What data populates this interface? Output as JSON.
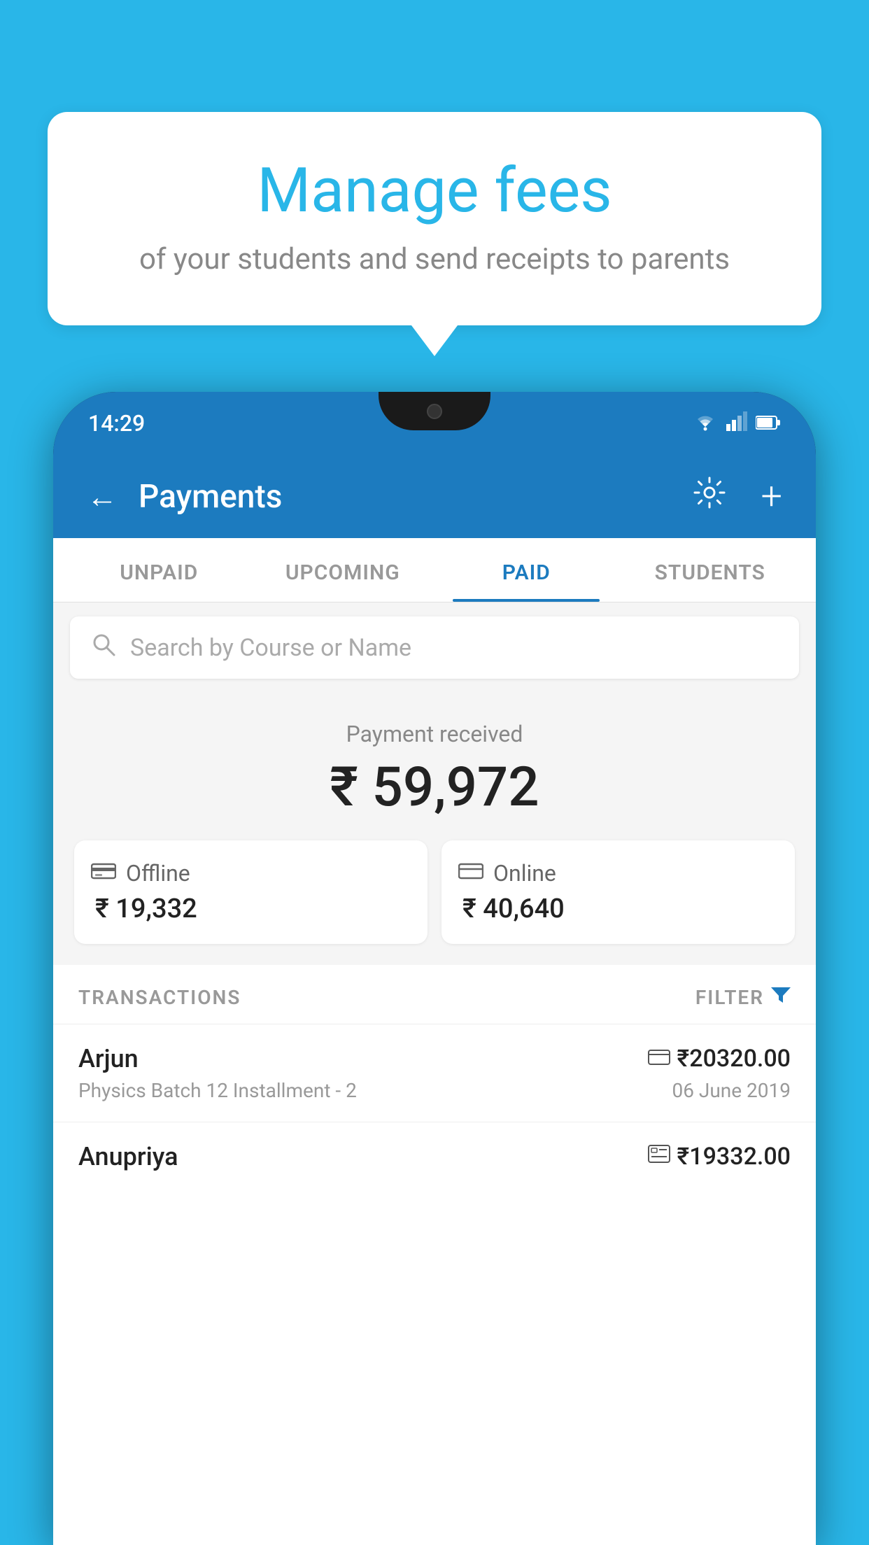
{
  "background_color": "#29B6E8",
  "bubble": {
    "title": "Manage fees",
    "subtitle": "of your students and send receipts to parents"
  },
  "status_bar": {
    "time": "14:29",
    "wifi": "▲",
    "signal": "▲",
    "battery": "▉"
  },
  "header": {
    "back_label": "←",
    "title": "Payments",
    "gear_label": "⚙",
    "plus_label": "+"
  },
  "tabs": [
    {
      "label": "UNPAID",
      "active": false
    },
    {
      "label": "UPCOMING",
      "active": false
    },
    {
      "label": "PAID",
      "active": true
    },
    {
      "label": "STUDENTS",
      "active": false
    }
  ],
  "search": {
    "placeholder": "Search by Course or Name"
  },
  "payment_summary": {
    "label": "Payment received",
    "total": "₹ 59,972",
    "offline": {
      "type": "Offline",
      "amount": "₹ 19,332"
    },
    "online": {
      "type": "Online",
      "amount": "₹ 40,640"
    }
  },
  "transactions_section": {
    "label": "TRANSACTIONS",
    "filter_label": "FILTER"
  },
  "transactions": [
    {
      "name": "Arjun",
      "mode_icon": "▬",
      "amount": "₹20320.00",
      "course": "Physics Batch 12 Installment - 2",
      "date": "06 June 2019"
    },
    {
      "name": "Anupriya",
      "mode_icon": "▣",
      "amount": "₹19332.00",
      "course": "",
      "date": ""
    }
  ]
}
